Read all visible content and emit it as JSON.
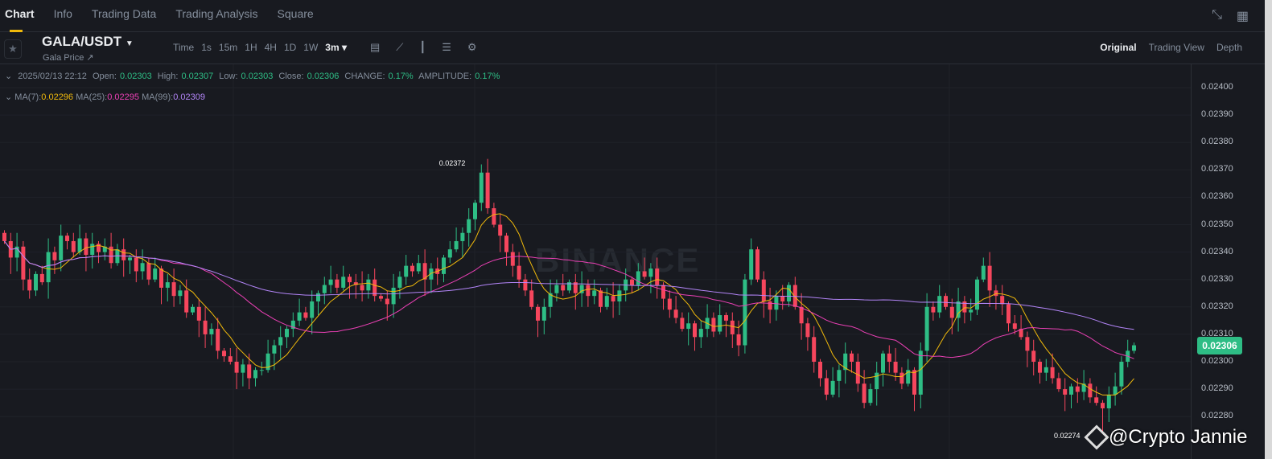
{
  "tabs": [
    "Chart",
    "Info",
    "Trading Data",
    "Trading Analysis",
    "Square"
  ],
  "pair": "GALA/USDT",
  "pair_sub": "Gala Price ↗",
  "intervals": [
    "Time",
    "1s",
    "15m",
    "1H",
    "4H",
    "1D",
    "1W",
    "3m ▾"
  ],
  "views": [
    "Original",
    "Trading View",
    "Depth"
  ],
  "info": {
    "date": "2025/02/13 22:12",
    "open_l": "Open:",
    "open": "0.02303",
    "high_l": "High:",
    "high": "0.02307",
    "low_l": "Low:",
    "low": "0.02303",
    "close_l": "Close:",
    "close": "0.02306",
    "change_l": "CHANGE:",
    "change": "0.17%",
    "amp_l": "AMPLITUDE:",
    "amp": "0.17%"
  },
  "ma": {
    "ma7_l": "MA(7):",
    "ma7": "0.02296",
    "ma25_l": "MA(25):",
    "ma25": "0.02295",
    "ma99_l": "MA(99):",
    "ma99": "0.02309"
  },
  "axis": [
    "0.02400",
    "0.02390",
    "0.02380",
    "0.02370",
    "0.02360",
    "0.02350",
    "0.02340",
    "0.02330",
    "0.02320",
    "0.02310",
    "0.02300",
    "0.02290",
    "0.02280"
  ],
  "current_price": "0.02306",
  "high_label": "0.02372",
  "low_label": "0.02274",
  "watermark": "BINANCE",
  "credit": "@Crypto Jannie",
  "colors": {
    "up": "#2ebd85",
    "down": "#f6465d",
    "ma7": "#f0b90b",
    "ma25": "#eb40b5",
    "ma99": "#b385f8"
  },
  "chart_data": {
    "type": "candlestick",
    "unit": "1e-5 USDT",
    "high_index": 76,
    "high": 2372,
    "low_index": 175,
    "low": 2274,
    "closes": [
      2344,
      2338,
      2342,
      2330,
      2326,
      2332,
      2329,
      2340,
      2337,
      2346,
      2344,
      2340,
      2345,
      2339,
      2343,
      2340,
      2342,
      2336,
      2341,
      2337,
      2338,
      2333,
      2336,
      2330,
      2334,
      2327,
      2329,
      2324,
      2326,
      2318,
      2320,
      2315,
      2310,
      2312,
      2304,
      2302,
      2300,
      2296,
      2299,
      2294,
      2297,
      2297,
      2303,
      2306,
      2309,
      2312,
      2315,
      2318,
      2316,
      2322,
      2325,
      2328,
      2330,
      2327,
      2331,
      2329,
      2328,
      2326,
      2330,
      2324,
      2323,
      2321,
      2327,
      2331,
      2335,
      2333,
      2336,
      2330,
      2334,
      2332,
      2338,
      2341,
      2344,
      2347,
      2352,
      2358,
      2369,
      2356,
      2350,
      2346,
      2340,
      2335,
      2330,
      2326,
      2320,
      2315,
      2320,
      2325,
      2328,
      2326,
      2329,
      2325,
      2328,
      2324,
      2326,
      2320,
      2324,
      2322,
      2326,
      2330,
      2328,
      2333,
      2331,
      2334,
      2328,
      2323,
      2319,
      2316,
      2312,
      2314,
      2309,
      2312,
      2316,
      2311,
      2317,
      2315,
      2310,
      2306,
      2330,
      2341,
      2330,
      2322,
      2319,
      2324,
      2322,
      2328,
      2320,
      2314,
      2309,
      2300,
      2294,
      2288,
      2293,
      2297,
      2303,
      2300,
      2292,
      2285,
      2290,
      2296,
      2303,
      2300,
      2296,
      2292,
      2297,
      2288,
      2304,
      2320,
      2318,
      2324,
      2320,
      2316,
      2322,
      2318,
      2319,
      2330,
      2335,
      2326,
      2324,
      2321,
      2314,
      2312,
      2309,
      2304,
      2300,
      2296,
      2298,
      2294,
      2290,
      2288,
      2291,
      2289,
      2292,
      2287,
      2285,
      2283,
      2288,
      2291,
      2300,
      2304,
      2306
    ]
  }
}
